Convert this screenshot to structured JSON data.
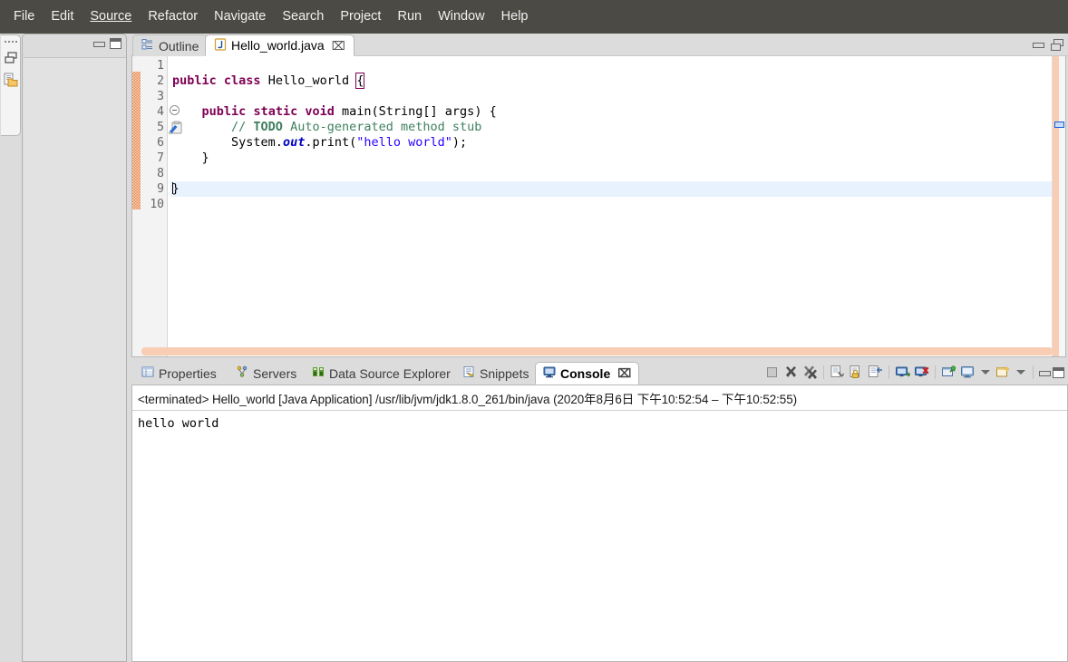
{
  "menubar": {
    "items": [
      {
        "label": "File",
        "mnemonic_index": -1
      },
      {
        "label": "Edit",
        "mnemonic_index": -1
      },
      {
        "label": "Source",
        "mnemonic_index": 0
      },
      {
        "label": "Refactor",
        "mnemonic_index": 5
      },
      {
        "label": "Navigate",
        "mnemonic_index": -1
      },
      {
        "label": "Search",
        "mnemonic_index": -1
      },
      {
        "label": "Project",
        "mnemonic_index": -1
      },
      {
        "label": "Run",
        "mnemonic_index": -1
      },
      {
        "label": "Window",
        "mnemonic_index": -1
      },
      {
        "label": "Help",
        "mnemonic_index": -1
      }
    ]
  },
  "trimstack": {
    "restore_tooltip": "Restore",
    "package_explorer_tooltip": "Package Explorer"
  },
  "left_panel": {
    "minimize_tooltip": "Minimize",
    "maximize_tooltip": "Maximize"
  },
  "editor": {
    "tabs": [
      {
        "label": "Outline",
        "icon": "outline-icon",
        "active": false,
        "closable": false
      },
      {
        "label": "Hello_world.java",
        "icon": "java-file-icon",
        "active": true,
        "closable": true
      }
    ],
    "close_glyph": "⌧",
    "minimize_tooltip": "Minimize",
    "restore_tooltip": "Restore",
    "line_numbers": [
      "1",
      "2",
      "3",
      "4",
      "5",
      "6",
      "7",
      "8",
      "9",
      "10"
    ],
    "current_line": 9,
    "code_lines": [
      {
        "n": 1,
        "text": ""
      },
      {
        "n": 2,
        "text": "public class Hello_world {"
      },
      {
        "n": 3,
        "text": ""
      },
      {
        "n": 4,
        "text": "    public static void main(String[] args) {"
      },
      {
        "n": 5,
        "text": "        // TODO Auto-generated method stub"
      },
      {
        "n": 6,
        "text": "        System.out.print(\"hello world\");"
      },
      {
        "n": 7,
        "text": "    }"
      },
      {
        "n": 8,
        "text": ""
      },
      {
        "n": 9,
        "text": "}"
      },
      {
        "n": 10,
        "text": ""
      }
    ],
    "tokens": {
      "kw_public": "public",
      "kw_class": "class",
      "kw_static": "static",
      "kw_void": "void",
      "type_name": "Hello_world",
      "brace_open": "{",
      "method_main": "main(String[] args) {",
      "comment_slashes": "// ",
      "comment_todo": "TODO",
      "comment_rest": " Auto-generated method stub",
      "sys": "System.",
      "out": "out",
      "print_call": ".print(",
      "string_lit": "\"hello world\"",
      "print_end": ");",
      "close_inner": "}",
      "close_outer": "}"
    },
    "colors": {
      "keyword": "#7F0055",
      "string": "#2A00FF",
      "comment": "#3F7F5F",
      "field": "#0000C0",
      "current_line_bg": "#E8F2FE",
      "change_bar": "#E8722B",
      "overview_stripe": "#F9CDB3"
    }
  },
  "bottom_panel": {
    "tabs": [
      {
        "label": "Properties",
        "icon": "properties-icon",
        "active": false
      },
      {
        "label": "Servers",
        "icon": "servers-icon",
        "active": false
      },
      {
        "label": "Data Source Explorer",
        "icon": "data-source-icon",
        "active": false
      },
      {
        "label": "Snippets",
        "icon": "snippets-icon",
        "active": false
      },
      {
        "label": "Console",
        "icon": "console-icon",
        "active": true
      }
    ],
    "close_glyph": "⌧",
    "toolbar": [
      {
        "name": "terminate-button",
        "tooltip": "Terminate"
      },
      {
        "name": "remove-launch-button",
        "tooltip": "Remove Launch"
      },
      {
        "name": "remove-all-terminated-button",
        "tooltip": "Remove All Terminated Launches"
      },
      {
        "name": "clear-console-button",
        "tooltip": "Clear Console"
      },
      {
        "name": "scroll-lock-button",
        "tooltip": "Scroll Lock"
      },
      {
        "name": "word-wrap-button",
        "tooltip": "Word Wrap"
      },
      {
        "name": "show-console-on-output-button",
        "tooltip": "Show Console When Standard Out Changes"
      },
      {
        "name": "show-console-on-error-button",
        "tooltip": "Show Console When Standard Error Changes"
      },
      {
        "name": "pin-console-button",
        "tooltip": "Pin Console"
      },
      {
        "name": "display-selected-console-button",
        "tooltip": "Display Selected Console"
      },
      {
        "name": "display-selected-console-dropdown",
        "tooltip": "Display Selected Console"
      },
      {
        "name": "open-console-button",
        "tooltip": "Open Console"
      },
      {
        "name": "open-console-dropdown",
        "tooltip": "Open Console"
      },
      {
        "name": "minimize-button",
        "tooltip": "Minimize"
      },
      {
        "name": "maximize-button",
        "tooltip": "Maximize"
      }
    ]
  },
  "console": {
    "status_prefix": "<terminated>",
    "launch_name": "Hello_world [Java Application]",
    "jvm_path": "/usr/lib/jvm/jdk1.8.0_261/bin/java",
    "timestamp": "(2020年8月6日 下午10:52:54 – 下午10:52:55)",
    "header_full": "<terminated> Hello_world [Java Application] /usr/lib/jvm/jdk1.8.0_261/bin/java (2020年8月6日 下午10:52:54 – 下午10:52:55)",
    "output": "hello world"
  }
}
